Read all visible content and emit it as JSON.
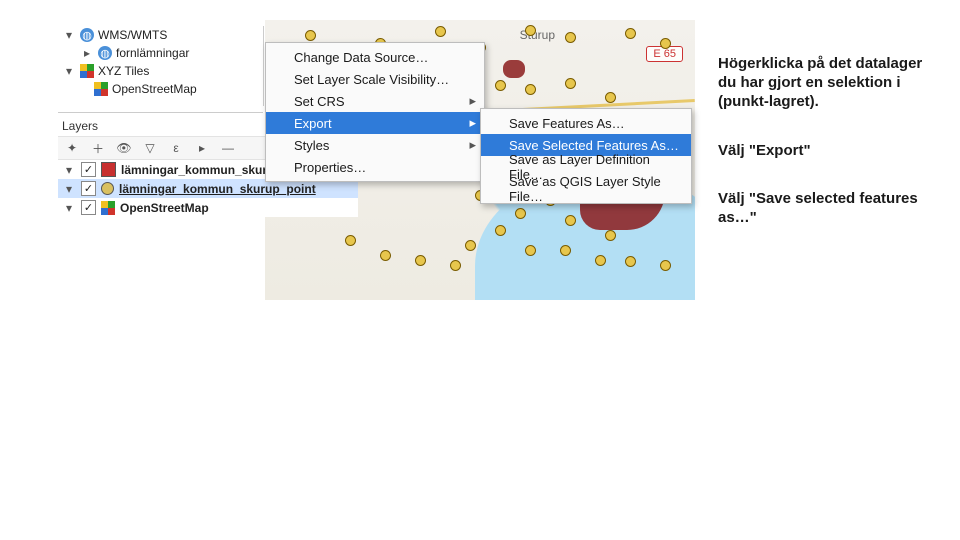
{
  "browser_tree": {
    "wms_group": "WMS/WMTS",
    "wms_child": "fornlämningar",
    "xyz_group": "XYZ Tiles",
    "xyz_child": "OpenStreetMap"
  },
  "layers_panel": {
    "title": "Layers",
    "items": [
      {
        "name": "lämningar_kommun_skuru",
        "swatch": "square-red",
        "checked": true
      },
      {
        "name": "lämningar_kommun_skurup_point",
        "swatch": "circle-yellow",
        "checked": true,
        "selected": true
      },
      {
        "name": "OpenStreetMap",
        "swatch": "xyz",
        "checked": true
      }
    ]
  },
  "context_menu": {
    "items": [
      {
        "label": "Change Data Source…",
        "submenu": false
      },
      {
        "label": "Set Layer Scale Visibility…",
        "submenu": false
      },
      {
        "label": "Set CRS",
        "submenu": true
      },
      {
        "label": "Export",
        "submenu": true,
        "selected": true
      },
      {
        "label": "Styles",
        "submenu": true
      },
      {
        "label": "Properties…",
        "submenu": false
      }
    ],
    "sub_items": [
      {
        "label": "Save Features As…"
      },
      {
        "label": "Save Selected Features As…",
        "selected": true
      },
      {
        "label": "Save as Layer Definition File…"
      },
      {
        "label": "Save as QGIS Layer Style File…"
      }
    ]
  },
  "map": {
    "label_sturup": "Sturup",
    "badge": "E 65"
  },
  "instructions": {
    "a": "Högerklicka på det datalager du har gjort en selektion i (punkt-lagret).",
    "b": "Välj \"Export\"",
    "c": "Välj \"Save selected features as…\""
  }
}
